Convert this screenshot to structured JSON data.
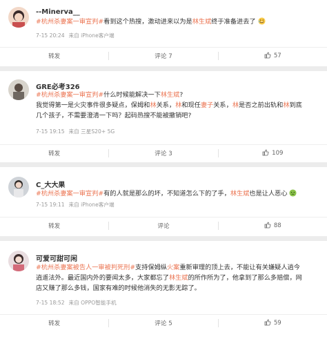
{
  "posts": [
    {
      "user": "--Minerva__",
      "line1_tag": "#杭州杀妻案一审宣判#",
      "line1_text_a": "看到这个热搜，激动进来以为是",
      "line1_hl": "林生斌",
      "line1_text_b": "终于准备进去了",
      "emoji": "laugh-cry-emoji",
      "time": "7-15 20:24",
      "source": "来自 iPhone客户端",
      "repost": "转发",
      "comment": "评论 7",
      "likes": "57"
    },
    {
      "user": "GRE必考326",
      "line1_tag": "#杭州杀妻案一审宣判#",
      "line1_text_a": "什么时候能解决一下",
      "line1_hl": "林生斌",
      "line1_text_b": "?",
      "line2_a": "我觉得第一是火灾事件很多疑点，保姆和",
      "line2_hl1": "林",
      "line2_b": "关系，",
      "line2_hl2": "林",
      "line2_c": "和现任",
      "line2_hl3": "妻子",
      "line2_d": "关系，",
      "line2_hl4": "林",
      "line2_e": "是否之前出轨和",
      "line2_hl5": "林",
      "line2_f": "到底",
      "line3": "几个孩子，不需要澄清一下吗？起码热搜不能被撤销吧?",
      "time": "7-15 19:15",
      "source": "来自 三星S20+ 5G",
      "repost": "转发",
      "comment": "评论 3",
      "likes": "109"
    },
    {
      "user": "C_大大果",
      "line1_tag": "#杭州杀妻案一审宣判#",
      "line1_text_a": "有的人就是那么的坏，不知道怎么下的了手，",
      "line1_hl": "林生斌",
      "line1_text_b": "也是让人恶心",
      "emoji": "sick-face-emoji",
      "time": "7-15 19:11",
      "source": "来自 iPhone客户端",
      "repost": "转发",
      "comment": "评论",
      "likes": "88"
    },
    {
      "user": "可爱可甜可闲",
      "line1_tag": "#杭州杀妻案被告人一审被判死刑#",
      "line1_text_a": "支持保姆纵",
      "line1_hl": "火案",
      "line1_text_b": "重新审理的顶上去，不能让有关嫌疑人逍今",
      "line2_a": "逍遥法外。最近国内外的要闻太多，大家都忘了",
      "line2_hl1": "林生斌",
      "line2_b": "的所作所为了，他拿到了那么多赔偿，网",
      "line3": "店又赚了那么多钱，国家有难的时候他消失的无影无踪了。",
      "time": "7-15 18:52",
      "source": "来自 OPPO智能手机",
      "repost": "转发",
      "comment": "评论 5",
      "likes": "59"
    }
  ]
}
